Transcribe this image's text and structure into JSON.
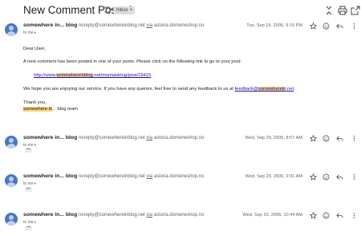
{
  "header": {
    "subject": "New Comment Posted",
    "inbox_chip": "Inbox",
    "chip_close": "×"
  },
  "messages": [
    {
      "sender_name": "somewhere in... blog",
      "sender_email": "noreply@somewhereinblog.net",
      "via_label": "via",
      "via_domain": "astoria.domeneshop.no",
      "to": "to me",
      "date": "Tue, Sep 19, 2006, 9:19 PM"
    },
    {
      "sender_name": "somewhere in... blog",
      "sender_email": "noreply@somewhereinblog.net",
      "via_label": "via",
      "via_domain": "astoria.domeneshop.no",
      "to": "to me",
      "date": "Wed, Sep 20, 2006, 8:57 AM"
    },
    {
      "sender_name": "somewhere in... blog",
      "sender_email": "noreply@somewhereinblog.net",
      "via_label": "via",
      "via_domain": "astoria.domeneshop.no",
      "to": "to me",
      "date": "Wed, Sep 20, 2006, 9:31 AM"
    },
    {
      "sender_name": "somewhere in... blog",
      "sender_email": "noreply@somewhereinblog.net",
      "via_label": "via",
      "via_domain": "astoria.domeneshop.no",
      "to": "to me",
      "date": "Wed, Sep 20, 2006, 10:44 AM"
    }
  ],
  "email_body": {
    "greeting": "Dear User,",
    "intro": "A new comment has been posted in one of your posts. Please click on the following link to go to your post:",
    "link_pre": "http://www.",
    "link_hl": "somewhereinblog",
    "link_post": ".net/munlaisblog/post/19415",
    "feedback_pre": "We hope you are enjoying our service, If you have any queries, feel free to send any feedback to us at ",
    "feedback_link_pre": "feedback@",
    "feedback_link_hl": "somewherein",
    "feedback_link_post": ".net",
    "feedback_end": ".",
    "thanks": "Thank you,",
    "signoff_hl": "somewhere in",
    "signoff_rest": "... blog team"
  },
  "colors": {
    "highlight": "#f7d37a",
    "link": "#1a0dab",
    "avatar": "#4a76c9"
  }
}
